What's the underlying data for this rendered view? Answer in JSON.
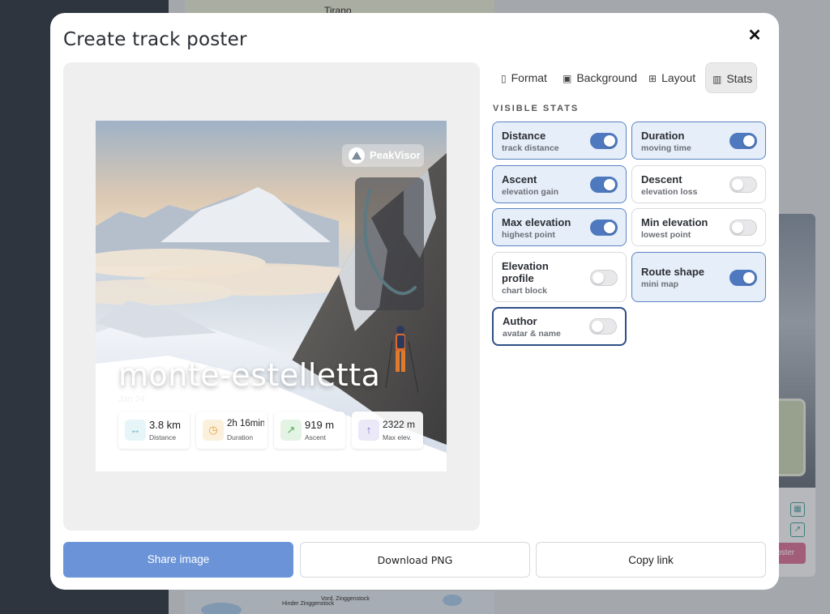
{
  "background": {
    "map_labels": [
      "Tirano",
      "Hinder Zinggenstock",
      "Vord. Zinggenstock"
    ],
    "card_button_label": "oster"
  },
  "modal": {
    "title": "Create track poster",
    "close_label": "✕"
  },
  "poster": {
    "brand": "PeakVisor",
    "title": "monte-estelletta",
    "date": "Jan 24",
    "stats": [
      {
        "value": "3.8 km",
        "label": "Distance",
        "icon": "distance-icon",
        "color": "#5bb8c9"
      },
      {
        "value": "2h 16min",
        "label": "Duration",
        "icon": "clock-icon",
        "color": "#e0a33a"
      },
      {
        "value": "919 m",
        "label": "Ascent",
        "icon": "arrow-up-right-icon",
        "color": "#4caf50"
      },
      {
        "value": "2322 m",
        "label": "Max elev.",
        "icon": "arrow-up-icon",
        "color": "#7b6fd0"
      }
    ]
  },
  "tabs": [
    {
      "label": "Format",
      "icon": "phone-icon",
      "active": false
    },
    {
      "label": "Background",
      "icon": "image-icon",
      "active": false
    },
    {
      "label": "Layout",
      "icon": "grid-icon",
      "active": false
    },
    {
      "label": "Stats",
      "icon": "bars-icon",
      "active": true
    }
  ],
  "visible_stats_label": "VISIBLE STATS",
  "stats_options": [
    {
      "title": "Distance",
      "subtitle": "track distance",
      "enabled": true
    },
    {
      "title": "Duration",
      "subtitle": "moving time",
      "enabled": true
    },
    {
      "title": "Ascent",
      "subtitle": "elevation gain",
      "enabled": true
    },
    {
      "title": "Descent",
      "subtitle": "elevation loss",
      "enabled": false
    },
    {
      "title": "Max elevation",
      "subtitle": "highest point",
      "enabled": true
    },
    {
      "title": "Min elevation",
      "subtitle": "lowest point",
      "enabled": false
    },
    {
      "title": "Elevation profile",
      "subtitle": "chart block",
      "enabled": false
    },
    {
      "title": "Route shape",
      "subtitle": "mini map",
      "enabled": true
    },
    {
      "title": "Author",
      "subtitle": "avatar & name",
      "enabled": false
    }
  ],
  "footer": {
    "share_label": "Share image",
    "download_label": "Download PNG",
    "copy_label": "Copy link"
  },
  "colors": {
    "primary": "#6b94d8",
    "toggle_on": "#4f79bf",
    "card_on_bg": "#e6eef9"
  }
}
